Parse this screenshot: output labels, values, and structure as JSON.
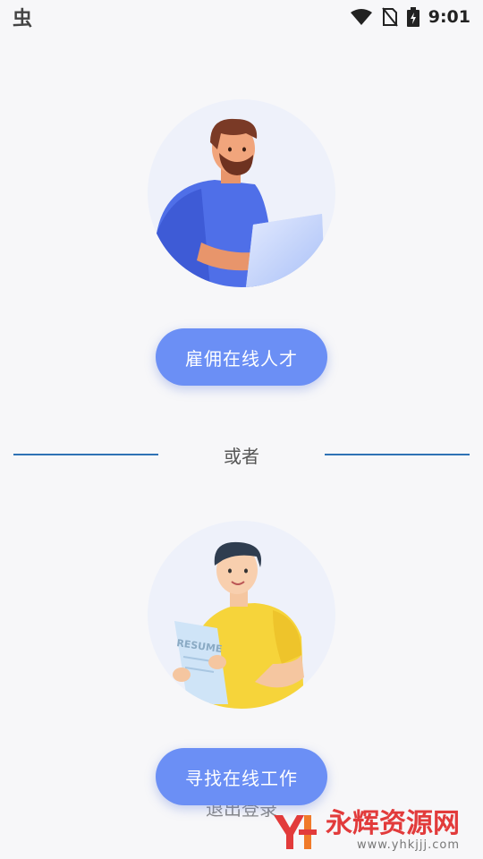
{
  "status_bar": {
    "time": "9:01",
    "left_icon": "app-logo-glyph",
    "left_glyph": "虫"
  },
  "hire": {
    "illustration": "man-with-laptop",
    "button_label": "雇佣在线人才"
  },
  "divider": {
    "label": "或者"
  },
  "find": {
    "illustration": "man-holding-resume",
    "resume_text": "RESUME",
    "button_label": "寻找在线工作"
  },
  "logout_label": "退出登录",
  "watermark": {
    "brand": "永辉资源网",
    "url": "www.yhkjjj.com"
  },
  "colors": {
    "button": "#6b8ff5",
    "divider": "#2f72b5",
    "background": "#f7f7f9",
    "watermark": "#e23b3b"
  }
}
